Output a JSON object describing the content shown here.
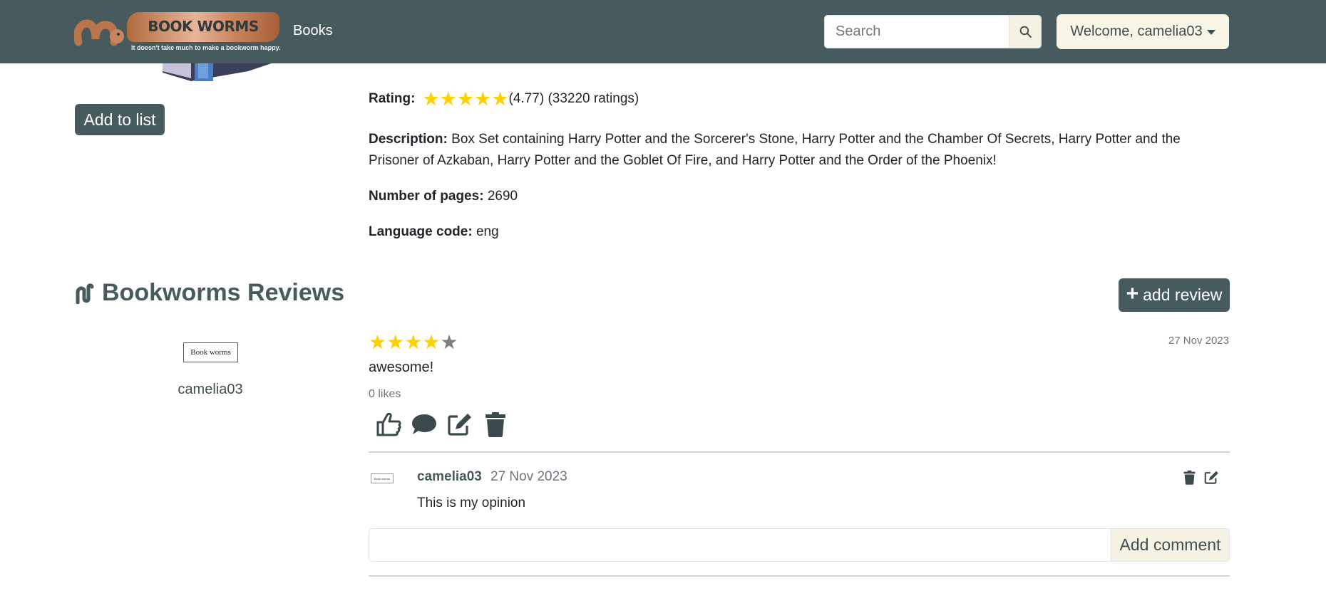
{
  "navbar": {
    "logo_text": "BOOK WORMS",
    "logo_tagline": "It doesn't take much to make a bookworm happy.",
    "books_link": "Books",
    "search_placeholder": "Search",
    "welcome": "Welcome, camelia03"
  },
  "book": {
    "add_to_list": "Add to list",
    "rating_label": "Rating:",
    "rating_value": 4.77,
    "rating_text": "(4.77) (33220 ratings)",
    "description_label": "Description:",
    "description": "Box Set containing Harry Potter and the Sorcerer's Stone, Harry Potter and the Chamber Of Secrets, Harry Potter and the Prisoner of Azkaban, Harry Potter and the Goblet Of Fire, and Harry Potter and the Order of the Phoenix!",
    "pages_label": "Number of pages:",
    "pages": "2690",
    "language_label": "Language code:",
    "language": "eng"
  },
  "reviews": {
    "title": "Bookworms Reviews",
    "add_review": "add review",
    "items": [
      {
        "avatar_text": "Book worms",
        "user": "camelia03",
        "stars": 4,
        "max_stars": 5,
        "date": "27 Nov 2023",
        "text": "awesome!",
        "likes": "0 likes",
        "comments": [
          {
            "user": "camelia03",
            "date": "27 Nov 2023",
            "text": "This is my opinion"
          }
        ]
      }
    ],
    "add_comment": "Add comment"
  },
  "colors": {
    "primary": "#475b5e",
    "star": "#ffd000",
    "star_empty": "#7d7d7d",
    "cream": "#f5f2e3"
  },
  "icons": [
    "search-icon",
    "like-icon",
    "comment-icon",
    "edit-icon",
    "trash-icon",
    "worm-icon"
  ]
}
